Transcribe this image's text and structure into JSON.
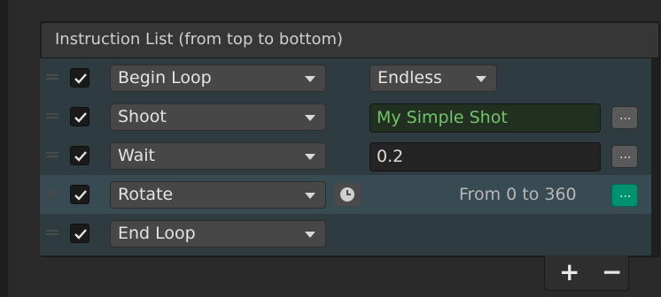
{
  "list": {
    "header": "Instruction List (from top to bottom)",
    "rows": [
      {
        "enabled": true,
        "instruction": "Begin Loop",
        "option": "Endless"
      },
      {
        "enabled": true,
        "instruction": "Shoot",
        "value": "My Simple Shot",
        "more": "..."
      },
      {
        "enabled": true,
        "instruction": "Wait",
        "value": "0.2",
        "more": "..."
      },
      {
        "enabled": true,
        "instruction": "Rotate",
        "summary": "From 0 to 360",
        "more": "...",
        "selected": true,
        "clock_icon": "clock-icon"
      },
      {
        "enabled": true,
        "instruction": "End Loop"
      }
    ]
  },
  "footer": {
    "add_label": "+",
    "remove_label": "−"
  },
  "colors": {
    "accent": "#00916f",
    "selected_row": "#384b53",
    "list_background": "#2e3b40",
    "shot_text": "#72c46b"
  }
}
